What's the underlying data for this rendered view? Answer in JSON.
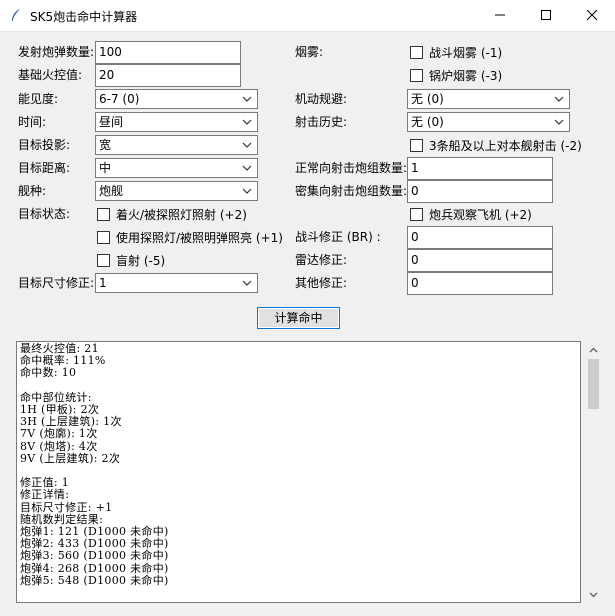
{
  "window": {
    "title": "SK5炮击命中计算器"
  },
  "left": {
    "shells_label": "发射炮弹数量:",
    "shells_value": "100",
    "base_label": "基础火控值:",
    "base_value": "20",
    "visibility_label": "能见度:",
    "visibility_value": "6-7 (0)",
    "time_label": "时间:",
    "time_value": "昼间",
    "projection_label": "目标投影:",
    "projection_value": "宽",
    "distance_label": "目标距离:",
    "distance_value": "中",
    "shiptype_label": "舰种:",
    "shiptype_value": "炮舰",
    "status_label": "目标状态:",
    "status_opt1": "着火/被探照灯照射 (+2)",
    "status_opt2": "使用探照灯/被照明弹照亮 (+1)",
    "status_opt3": "盲射 (-5)",
    "size_label": "目标尺寸修正:",
    "size_value": "1"
  },
  "right": {
    "smoke_label": "烟雾:",
    "smoke_opt1": "战斗烟雾 (-1)",
    "smoke_opt2": "锅炉烟雾 (-3)",
    "evasion_label": "机动规避:",
    "evasion_value": "无 (0)",
    "history_label": "射击历史:",
    "history_value": "无 (0)",
    "multi_opt": "3条船及以上对本舰射击 (-2)",
    "normal_groups_label": "正常向射击炮组数量:",
    "normal_groups_value": "1",
    "dense_groups_label": "密集向射击炮组数量:",
    "dense_groups_value": "0",
    "spotter_opt": "炮兵观察飞机 (+2)",
    "br_label": "战斗修正 (BR) :",
    "br_value": "0",
    "radar_label": "雷达修正:",
    "radar_value": "0",
    "other_label": "其他修正:",
    "other_value": "0"
  },
  "calc_button": "计算命中",
  "output_text": "最终火控值: 21\n命中概率: 111%\n命中数: 10\n\n命中部位统计:\n1H (甲板): 2次\n3H (上层建筑): 1次\n7V (炮廓): 1次\n8V (炮塔): 4次\n9V (上层建筑): 2次\n\n修正值: 1\n修正详情:\n目标尺寸修正: +1\n随机数判定结果:\n炮弹1: 121 (D1000 未命中)\n炮弹2: 433 (D1000 未命中)\n炮弹3: 560 (D1000 未命中)\n炮弹4: 268 (D1000 未命中)\n炮弹5: 548 (D1000 未命中)"
}
